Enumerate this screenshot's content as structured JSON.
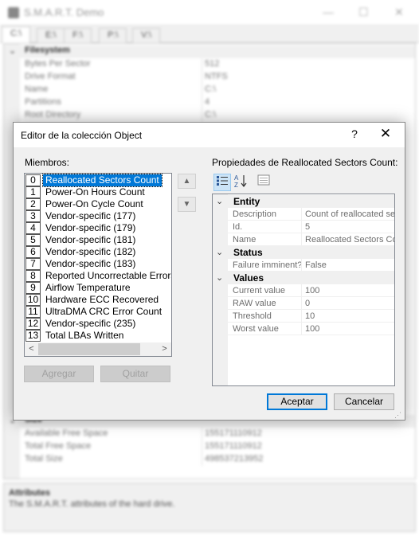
{
  "background": {
    "window_title": "S.M.A.R.T. Demo",
    "tabs": [
      "C:\\",
      "E:\\",
      "F:\\",
      "P:\\",
      "V:\\"
    ],
    "filesystem": {
      "category": "Filesystem",
      "rows": [
        {
          "key": "Bytes Per Sector",
          "value": "512"
        },
        {
          "key": "Drive Format",
          "value": "NTFS"
        },
        {
          "key": "Name",
          "value": "C:\\"
        },
        {
          "key": "Partitions",
          "value": "4"
        },
        {
          "key": "Root Directory",
          "value": "C:\\"
        }
      ]
    },
    "size": {
      "category": "Size",
      "rows": [
        {
          "key": "Available Free Space",
          "value": "155171110912"
        },
        {
          "key": "Total Free Space",
          "value": "155171110912"
        },
        {
          "key": "Total Size",
          "value": "498537213952"
        }
      ]
    },
    "description": {
      "title": "Attributes",
      "text": "The S.M.A.R.T. attributes of the hard drive."
    }
  },
  "dialog": {
    "title": "Editor de la colección Object",
    "help": "?",
    "close": "✕",
    "members_label": "Miembros:",
    "members": [
      {
        "index": "0",
        "name": "Reallocated Sectors Count"
      },
      {
        "index": "1",
        "name": "Power-On Hours Count"
      },
      {
        "index": "2",
        "name": "Power-On Cycle Count"
      },
      {
        "index": "3",
        "name": "Vendor-specific (177)"
      },
      {
        "index": "4",
        "name": "Vendor-specific (179)"
      },
      {
        "index": "5",
        "name": "Vendor-specific (181)"
      },
      {
        "index": "6",
        "name": "Vendor-specific (182)"
      },
      {
        "index": "7",
        "name": "Vendor-specific (183)"
      },
      {
        "index": "8",
        "name": "Reported Uncorrectable Errors"
      },
      {
        "index": "9",
        "name": "Airflow Temperature"
      },
      {
        "index": "10",
        "name": "Hardware ECC Recovered"
      },
      {
        "index": "11",
        "name": "UltraDMA CRC Error Count"
      },
      {
        "index": "12",
        "name": "Vendor-specific (235)"
      },
      {
        "index": "13",
        "name": "Total LBAs Written"
      }
    ],
    "selected_index": 0,
    "up_arrow": "▲",
    "down_arrow": "▼",
    "add_button": "Agregar",
    "remove_button": "Quitar",
    "properties_label": "Propiedades de Reallocated Sectors Count:",
    "properties": {
      "entity": {
        "category": "Entity",
        "rows": [
          {
            "key": "Description",
            "value": "Count of reallocated sectors"
          },
          {
            "key": "Id.",
            "value": "5"
          },
          {
            "key": "Name",
            "value": "Reallocated Sectors Count"
          }
        ]
      },
      "status": {
        "category": "Status",
        "rows": [
          {
            "key": "Failure imminent?",
            "value": "False"
          }
        ]
      },
      "values": {
        "category": "Values",
        "rows": [
          {
            "key": "Current value",
            "value": "100"
          },
          {
            "key": "RAW value",
            "value": "0"
          },
          {
            "key": "Threshold",
            "value": "10"
          },
          {
            "key": "Worst value",
            "value": "100"
          }
        ]
      }
    },
    "accept_button": "Aceptar",
    "cancel_button": "Cancelar"
  }
}
